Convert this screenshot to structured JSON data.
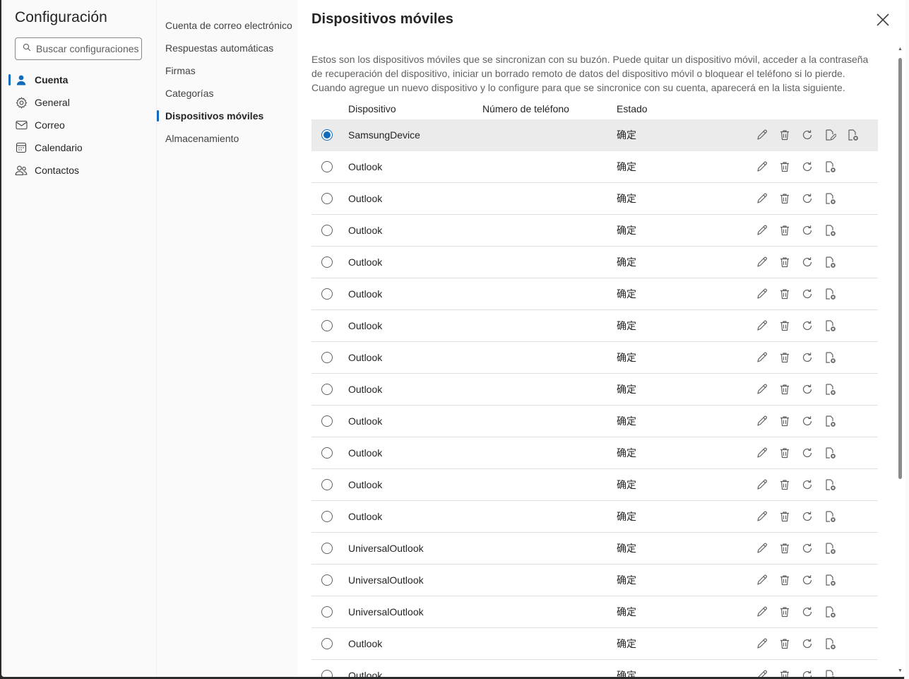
{
  "settings": {
    "title": "Configuración",
    "search_placeholder": "Buscar configuraciones"
  },
  "nav": [
    {
      "label": "Cuenta",
      "icon": "person-icon",
      "active": true
    },
    {
      "label": "General",
      "icon": "gear-icon",
      "active": false
    },
    {
      "label": "Correo",
      "icon": "mail-icon",
      "active": false
    },
    {
      "label": "Calendario",
      "icon": "calendar-icon",
      "active": false
    },
    {
      "label": "Contactos",
      "icon": "people-icon",
      "active": false
    }
  ],
  "subnav": [
    {
      "label": "Cuenta de correo electrónico",
      "active": false
    },
    {
      "label": "Respuestas automáticas",
      "active": false
    },
    {
      "label": "Firmas",
      "active": false
    },
    {
      "label": "Categorías",
      "active": false
    },
    {
      "label": "Dispositivos móviles",
      "active": true
    },
    {
      "label": "Almacenamiento",
      "active": false
    }
  ],
  "content": {
    "title": "Dispositivos móviles",
    "description": "Estos son los dispositivos móviles que se sincronizan con su buzón. Puede quitar un dispositivo móvil, acceder a la contraseña de recuperación del dispositivo, iniciar un borrado remoto de datos del dispositivo móvil o bloquear el teléfono si lo pierde. Cuando agregue un nuevo dispositivo y lo configure para que se sincronice con su cuenta, aparecerá en la lista siguiente."
  },
  "table": {
    "headers": {
      "device": "Dispositivo",
      "phone": "Número de teléfono",
      "status": "Estado"
    },
    "rows": [
      {
        "device": "SamsungDevice",
        "phone": "",
        "status": "确定",
        "selected": true
      },
      {
        "device": "Outlook",
        "phone": "",
        "status": "确定",
        "selected": false
      },
      {
        "device": "Outlook",
        "phone": "",
        "status": "确定",
        "selected": false
      },
      {
        "device": "Outlook",
        "phone": "",
        "status": "确定",
        "selected": false
      },
      {
        "device": "Outlook",
        "phone": "",
        "status": "确定",
        "selected": false
      },
      {
        "device": "Outlook",
        "phone": "",
        "status": "确定",
        "selected": false
      },
      {
        "device": "Outlook",
        "phone": "",
        "status": "确定",
        "selected": false
      },
      {
        "device": "Outlook",
        "phone": "",
        "status": "确定",
        "selected": false
      },
      {
        "device": "Outlook",
        "phone": "",
        "status": "确定",
        "selected": false
      },
      {
        "device": "Outlook",
        "phone": "",
        "status": "确定",
        "selected": false
      },
      {
        "device": "Outlook",
        "phone": "",
        "status": "确定",
        "selected": false
      },
      {
        "device": "Outlook",
        "phone": "",
        "status": "确定",
        "selected": false
      },
      {
        "device": "Outlook",
        "phone": "",
        "status": "确定",
        "selected": false
      },
      {
        "device": "UniversalOutlook",
        "phone": "",
        "status": "确定",
        "selected": false
      },
      {
        "device": "UniversalOutlook",
        "phone": "",
        "status": "确定",
        "selected": false
      },
      {
        "device": "UniversalOutlook",
        "phone": "",
        "status": "确定",
        "selected": false
      },
      {
        "device": "Outlook",
        "phone": "",
        "status": "确定",
        "selected": false
      },
      {
        "device": "Outlook",
        "phone": "",
        "status": "确定",
        "selected": false
      }
    ]
  },
  "colors": {
    "accent": "#0f6cbd",
    "selected_row": "#ebebeb",
    "icon": "#616161"
  }
}
